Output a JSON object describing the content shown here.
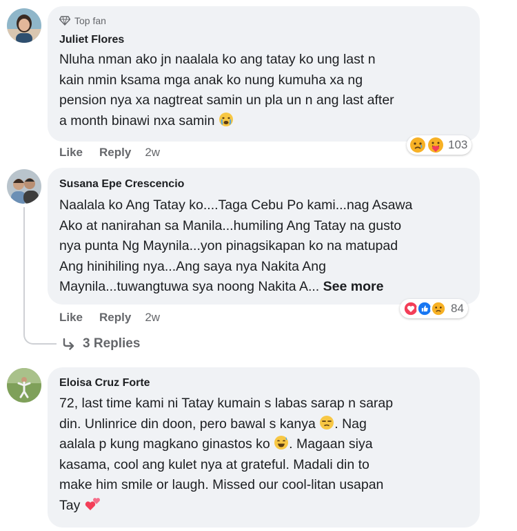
{
  "comments": [
    {
      "badge": "Top fan",
      "author": "Juliet Flores",
      "lines": [
        "Nluha nman ako jn naalala ko ang tatay ko ung last n",
        "kain nmin ksama mga anak ko nung kumuha xa ng",
        "pension nya xa nagtreat samin un pla un n ang last after",
        "a month binawi nxa samin"
      ],
      "actions": {
        "like": "Like",
        "reply": "Reply",
        "time": "2w"
      },
      "reaction_count": "103",
      "reaction_icons": [
        "sad-icon",
        "care-icon"
      ]
    },
    {
      "author": "Susana Epe Crescencio",
      "lines": [
        "Naalala ko Ang Tatay ko....Taga Cebu Po kami...nag Asawa",
        "Ako at nanirahan sa Manila...humiling Ang Tatay na gusto",
        "nya punta Ng Maynila...yon pinagsikapan ko na matupad",
        "Ang hinihiling nya...Ang saya nya Nakita Ang",
        "Maynila...tuwangtuwa sya noong Nakita A..."
      ],
      "see_more": "See more",
      "actions": {
        "like": "Like",
        "reply": "Reply",
        "time": "2w"
      },
      "reaction_count": "84",
      "reaction_icons": [
        "love-icon",
        "like-icon",
        "sad-icon"
      ],
      "replies_label": "3 Replies"
    },
    {
      "author": "Eloisa Cruz Forte",
      "lines": [
        "72, last time kami ni Tatay kumain s labas sarap n sarap",
        "din. Unlinrice din doon, pero bawal s kanya",
        ". Nag",
        "aalala p kung magkano ginastos ko",
        ". Magaan siya",
        "kasama, cool ang kulet nya at grateful. Madali din to",
        "make him smile or laugh. Missed our cool-litan usapan",
        "Tay"
      ]
    }
  ],
  "colors": {
    "bubble": "#f0f2f5",
    "text": "#1c1e21",
    "secondary": "#65676b",
    "love": "#f33e58",
    "like": "#1877f2",
    "sad": "#f7b125"
  }
}
